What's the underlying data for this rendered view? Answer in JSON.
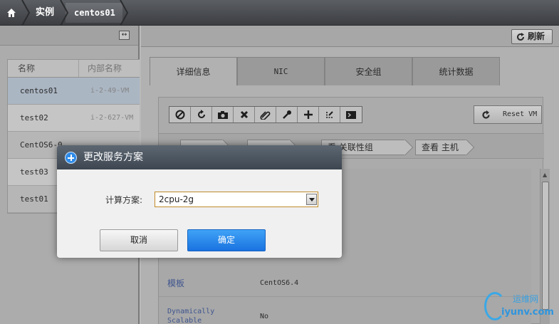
{
  "breadcrumb": {
    "instance": "实例",
    "vm": "centos01"
  },
  "list": {
    "columns": [
      "名称",
      "内部名称"
    ],
    "rows": [
      {
        "name": "centos01",
        "internal": "i-2-49-VM"
      },
      {
        "name": "test02",
        "internal": "i-2-627-VM"
      },
      {
        "name": "CentOS6-0",
        "internal": ""
      },
      {
        "name": "test03",
        "internal": ""
      },
      {
        "name": "test01",
        "internal": ""
      }
    ]
  },
  "toolbar": {
    "refresh_label": "刷新"
  },
  "tabs": [
    {
      "label": "详细信息"
    },
    {
      "label": "NIC"
    },
    {
      "label": "安全组"
    },
    {
      "label": "统计数据"
    }
  ],
  "actions": {
    "reset_vm": "Reset VM"
  },
  "views": {
    "view_affinity": "看 关联性组",
    "view_host": "查看 主机"
  },
  "details": {
    "rows": [
      {
        "key": "模板",
        "value": "CentOS6.4"
      },
      {
        "key": "Dynamically Scalable",
        "value": "No"
      }
    ]
  },
  "dialog": {
    "title": "更改服务方案",
    "field_label": "计算方案:",
    "selected_option": "2cpu-2g",
    "cancel_label": "取消",
    "ok_label": "确定"
  },
  "watermark": {
    "top": "运维网",
    "bottom": "iyunv.com"
  },
  "colors": {
    "dialog_ok": "#1a72e0",
    "dialog_title_bg": "#3d4651",
    "link": "#4a63a6"
  }
}
